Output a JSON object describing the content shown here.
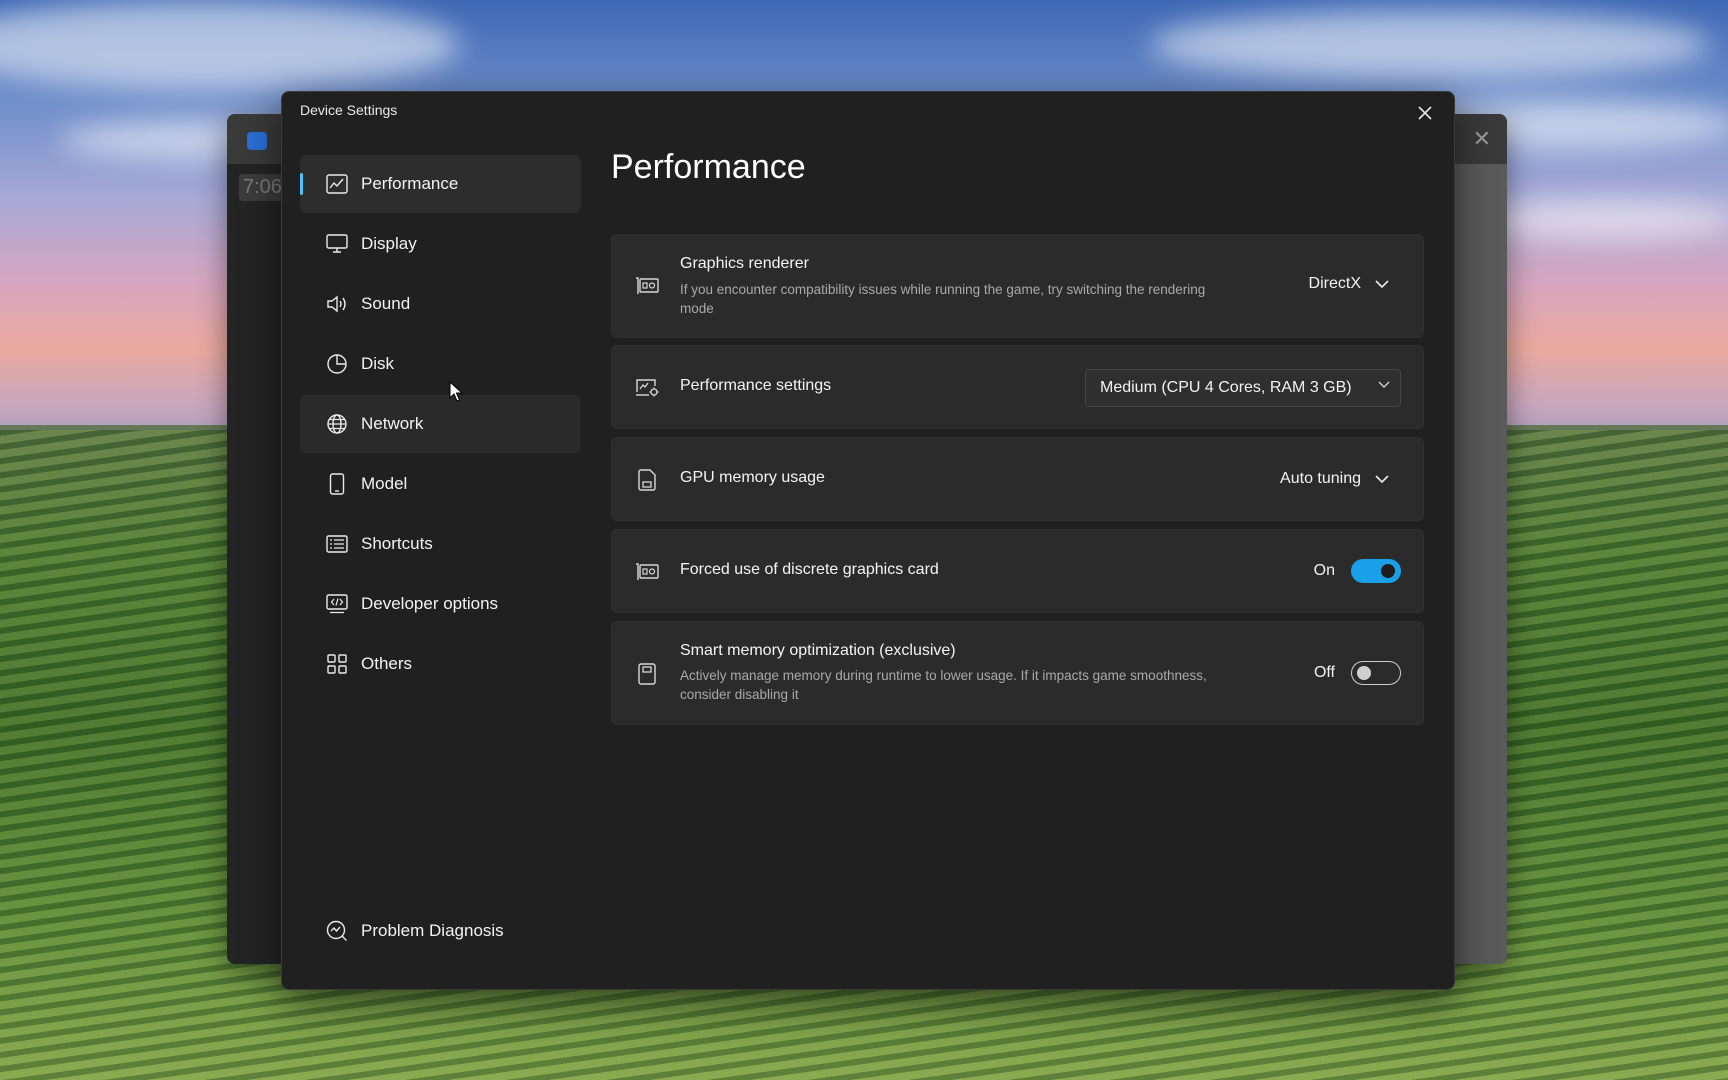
{
  "dialog": {
    "title": "Device Settings"
  },
  "background_window": {
    "time_fragment": "7:06"
  },
  "nav": {
    "items": [
      {
        "label": "Performance",
        "icon": "chart-icon"
      },
      {
        "label": "Display",
        "icon": "monitor-icon"
      },
      {
        "label": "Sound",
        "icon": "speaker-icon"
      },
      {
        "label": "Disk",
        "icon": "pie-chart-icon"
      },
      {
        "label": "Network",
        "icon": "globe-icon"
      },
      {
        "label": "Model",
        "icon": "phone-icon"
      },
      {
        "label": "Shortcuts",
        "icon": "keyboard-icon"
      },
      {
        "label": "Developer options",
        "icon": "code-window-icon"
      },
      {
        "label": "Others",
        "icon": "grid-icon"
      }
    ],
    "active": "Performance",
    "bottom": {
      "label": "Problem Diagnosis",
      "icon": "diagnosis-icon"
    }
  },
  "page": {
    "title": "Performance"
  },
  "settings": {
    "graphics_renderer": {
      "title": "Graphics renderer",
      "description": "If you encounter compatibility issues while running the game, try switching the rendering mode",
      "value": "DirectX"
    },
    "performance_settings": {
      "title": "Performance settings",
      "value": "Medium (CPU 4 Cores, RAM 3 GB)"
    },
    "gpu_memory": {
      "title": "GPU memory usage",
      "value": "Auto tuning"
    },
    "discrete_gpu": {
      "title": "Forced use of discrete graphics card",
      "state_label": "On",
      "enabled": true
    },
    "smart_memory": {
      "title": "Smart memory optimization (exclusive)",
      "description": "Actively manage memory during runtime to lower usage. If it impacts game smoothness, consider disabling it",
      "state_label": "Off",
      "enabled": false
    }
  },
  "colors": {
    "accent": "#4cc2ff",
    "toggle_on": "#1aa0e8",
    "dialog_bg": "#202020",
    "card_bg": "#2b2b2b"
  }
}
